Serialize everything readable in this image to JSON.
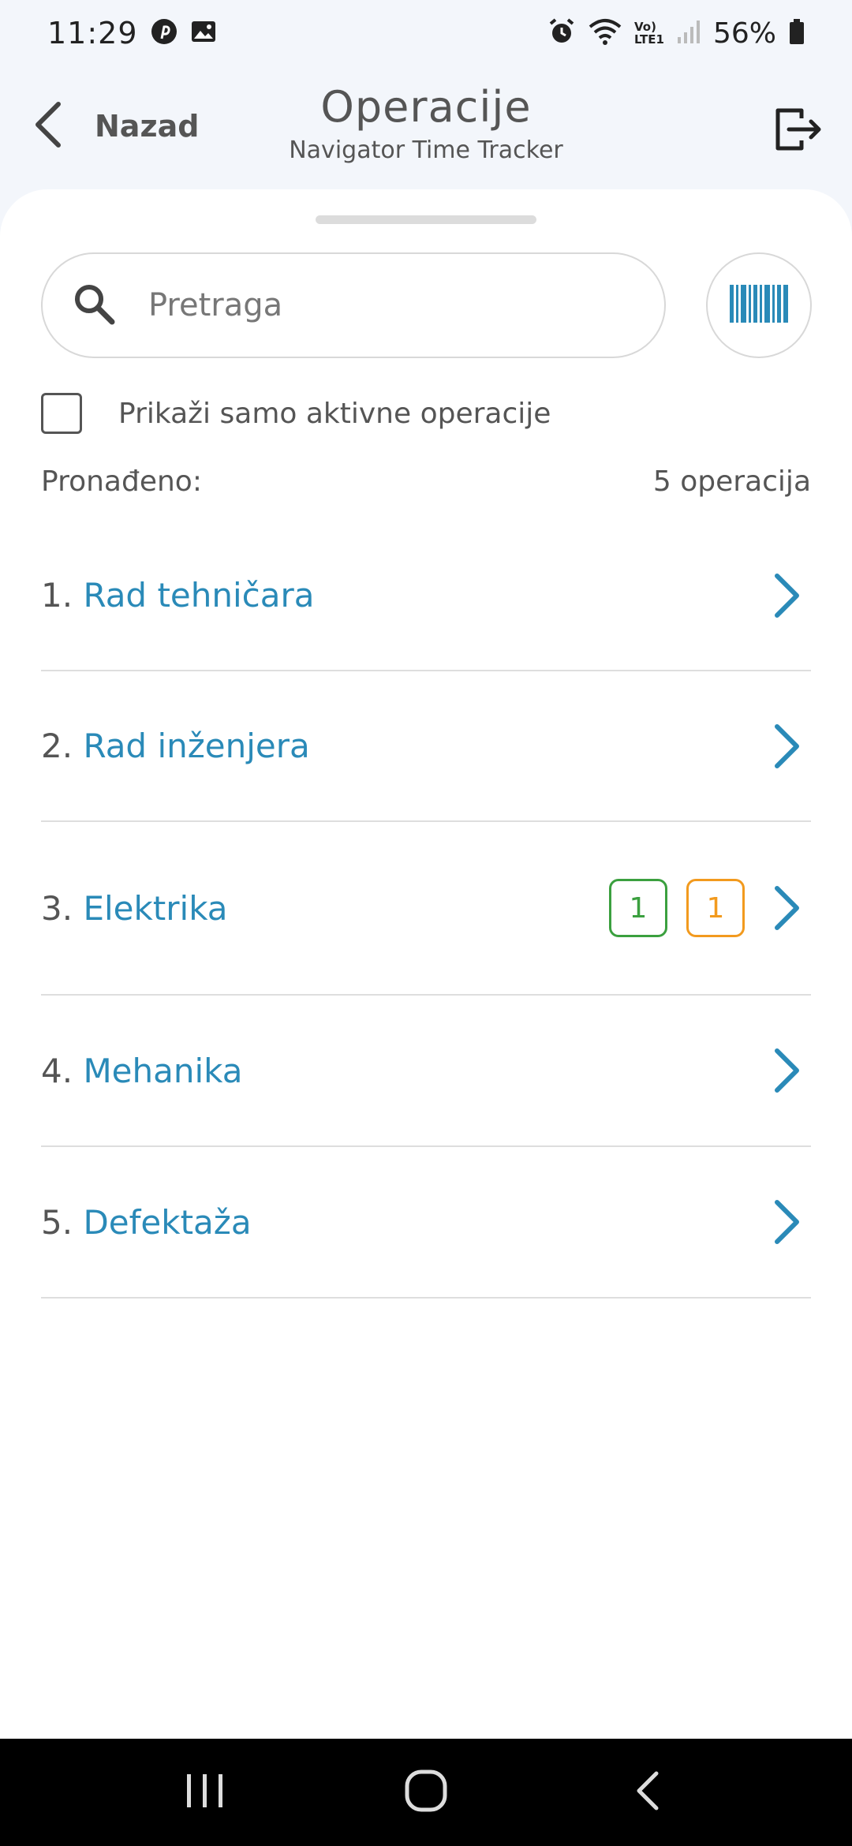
{
  "status_bar": {
    "time": "11:29",
    "battery_percent": "56%",
    "network_label_top": "Vo)",
    "network_label_bottom": "LTE1",
    "icons": [
      "pinterest-icon",
      "gallery-icon",
      "alarm-icon",
      "wifi-icon",
      "signal-icon",
      "battery-icon"
    ]
  },
  "header": {
    "back_label": "Nazad",
    "title": "Operacije",
    "subtitle": "Navigator Time Tracker"
  },
  "search": {
    "placeholder": "Pretraga",
    "value": ""
  },
  "filter": {
    "checkbox_label": "Prikaži samo aktivne operacije",
    "checked": false
  },
  "results": {
    "found_label": "Pronađeno:",
    "count_label": "5 operacija"
  },
  "operations": [
    {
      "num": "1.",
      "label": "Rad tehničara",
      "badges": []
    },
    {
      "num": "2.",
      "label": "Rad inženjera",
      "badges": []
    },
    {
      "num": "3.",
      "label": "Elektrika",
      "badges": [
        {
          "value": "1",
          "color": "green"
        },
        {
          "value": "1",
          "color": "orange"
        }
      ]
    },
    {
      "num": "4.",
      "label": "Mehanika",
      "badges": []
    },
    {
      "num": "5.",
      "label": "Defektaža",
      "badges": []
    }
  ],
  "colors": {
    "accent": "#2a8ab8",
    "badge_green": "#3ba03f",
    "badge_orange": "#f29a1e",
    "header_bg": "#f3f6fb"
  }
}
